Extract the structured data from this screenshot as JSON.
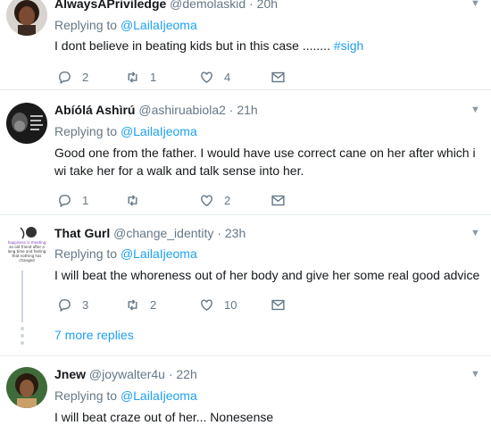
{
  "tweets": [
    {
      "name": "AlwaysAPriviledge",
      "handle": "@demolaskid",
      "dot": "·",
      "time": "20h",
      "replying_prefix": "Replying to",
      "replying_to": "@LailaIjeoma",
      "text": "I dont believe in beating kids but in this case ........",
      "hashtag": "#sigh",
      "replies": "2",
      "retweets": "1",
      "likes": "4"
    },
    {
      "name": "Abíólá Ashìrú",
      "handle": "@ashiruabiola2",
      "dot": "·",
      "time": "21h",
      "replying_prefix": "Replying to",
      "replying_to": "@LailaIjeoma",
      "text": "Good one from the father. I would have use correct cane on her after which i wi take her for a walk and talk sense into her.",
      "replies": "1",
      "retweets": "",
      "likes": "2"
    },
    {
      "name": "That Gurl",
      "handle": "@change_identity",
      "dot": "·",
      "time": "23h",
      "replying_prefix": "Replying to",
      "replying_to": "@LailaIjeoma",
      "text": "I will beat the whoreness out of her body and give her some real good advice",
      "replies": "3",
      "retweets": "2",
      "likes": "10",
      "more_replies": "7 more replies",
      "avatar_text": "happiness is meeting an old friend after a long time and feeling that nothing has changed"
    },
    {
      "name": "Jnew",
      "handle": "@joywalter4u",
      "dot": "·",
      "time": "22h",
      "replying_prefix": "Replying to",
      "replying_to": "@LailaIjeoma",
      "text": "I will beat craze out of her... Nonesense"
    }
  ],
  "icons": {
    "reply": "reply-icon",
    "retweet": "retweet-icon",
    "like": "heart-icon",
    "dm": "envelope-icon",
    "caret": "chevron-down-icon"
  },
  "colors": {
    "link": "#1da1f2",
    "muted": "#657786",
    "divider": "#e6ecf0"
  }
}
